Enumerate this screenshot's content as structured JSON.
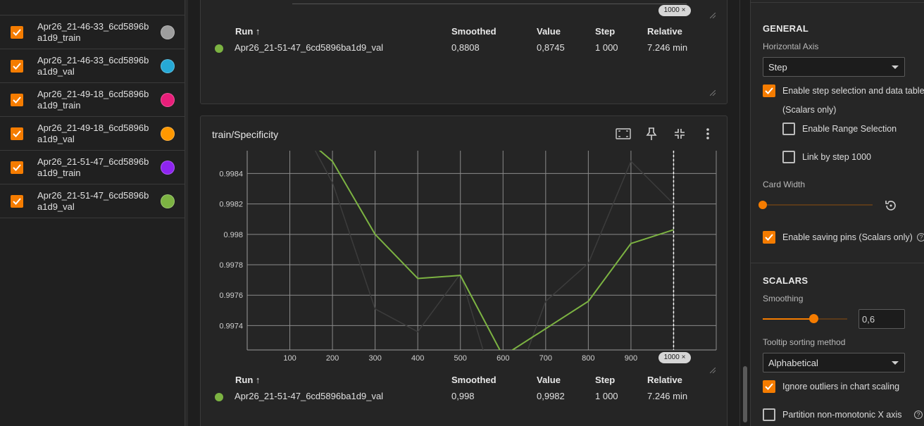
{
  "runs": [
    {
      "label": "Apr26_21-46-33_6cd5896ba1d9_train",
      "color": "#9e9e9e"
    },
    {
      "label": "Apr26_21-46-33_6cd5896ba1d9_val",
      "color": "#26a9d6"
    },
    {
      "label": "Apr26_21-49-18_6cd5896ba1d9_train",
      "color": "#e91e7a"
    },
    {
      "label": "Apr26_21-49-18_6cd5896ba1d9_val",
      "color": "#ff9800"
    },
    {
      "label": "Apr26_21-51-47_6cd5896ba1d9_train",
      "color": "#8e24f0"
    },
    {
      "label": "Apr26_21-51-47_6cd5896ba1d9_val",
      "color": "#7cb342"
    }
  ],
  "top_card": {
    "columns": {
      "run": "Run ↑",
      "smoothed": "Smoothed",
      "value": "Value",
      "step": "Step",
      "relative": "Relative"
    },
    "row": {
      "run": "Apr26_21-51-47_6cd5896ba1d9_val",
      "smoothed": "0,8808",
      "value": "0,8745",
      "step": "1 000",
      "relative": "7.246 min"
    },
    "step_badge": "1000 ×"
  },
  "chart_card": {
    "title": "train/Specificity",
    "icons": [
      "fit-domain-icon",
      "pin-icon",
      "collapse-icon",
      "more-vert-icon"
    ],
    "step_badge": "1000 ×",
    "columns": {
      "run": "Run ↑",
      "smoothed": "Smoothed",
      "value": "Value",
      "step": "Step",
      "relative": "Relative"
    },
    "row": {
      "run": "Apr26_21-51-47_6cd5896ba1d9_val",
      "smoothed": "0,998",
      "value": "0,9982",
      "step": "1 000",
      "relative": "7.246 min"
    }
  },
  "chart_data": {
    "type": "line",
    "title": "train/Specificity",
    "xlabel": "",
    "ylabel": "",
    "xlim": [
      0,
      1100
    ],
    "ylim": [
      0.99724,
      0.99855
    ],
    "x_ticks": [
      100,
      200,
      300,
      400,
      500,
      600,
      700,
      800,
      900
    ],
    "y_ticks": [
      "0.9974",
      "0.9976",
      "0.9978",
      "0.998",
      "0.9982",
      "0.9984"
    ],
    "grid": true,
    "series": [
      {
        "name": "Apr26_21-51-47_6cd5896ba1d9_val",
        "role": "smoothed",
        "color": "#7cb342",
        "x": [
          150,
          200,
          300,
          400,
          500,
          600,
          700,
          800,
          900,
          1000
        ],
        "y": [
          0.9986,
          0.99848,
          0.998,
          0.99771,
          0.99773,
          0.9972,
          0.99738,
          0.99756,
          0.99794,
          0.99803
        ]
      },
      {
        "name": "Apr26_21-51-47_6cd5896ba1d9_val",
        "role": "raw",
        "color": "#3c3c3c",
        "x": [
          150,
          200,
          300,
          400,
          500,
          600,
          700,
          800,
          900,
          1000
        ],
        "y": [
          0.9986,
          0.99834,
          0.99751,
          0.99736,
          0.99774,
          0.9968,
          0.99756,
          0.99781,
          0.99848,
          0.9982
        ]
      }
    ],
    "cursor_x": 1000
  },
  "settings": {
    "general_title": "GENERAL",
    "horizontal_axis_label": "Horizontal Axis",
    "horizontal_axis_value": "Step",
    "enable_step_selection": "Enable step selection and data table",
    "scalars_only": "(Scalars only)",
    "enable_range_selection": "Enable Range Selection",
    "link_by_step": "Link by step 1000",
    "card_width_label": "Card Width",
    "enable_saving_pins": "Enable saving pins (Scalars only)",
    "scalars_title": "SCALARS",
    "smoothing_label": "Smoothing",
    "smoothing_value": "0,6",
    "smoothing_fraction": 0.6,
    "tooltip_label": "Tooltip sorting method",
    "tooltip_value": "Alphabetical",
    "ignore_outliers": "Ignore outliers in chart scaling",
    "partition_non_monotonic": "Partition non-monotonic X axis",
    "accent_color": "#f57c00"
  }
}
